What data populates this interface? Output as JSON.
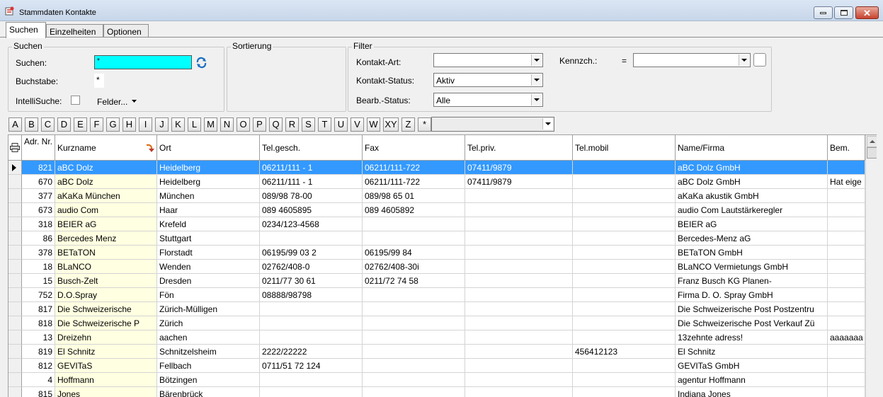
{
  "window": {
    "title": "Stammdaten Kontakte"
  },
  "tabs": [
    {
      "label": "Suchen"
    },
    {
      "label": "Einzelheiten"
    },
    {
      "label": "Optionen"
    }
  ],
  "search_group": {
    "title": "Suchen",
    "search_label": "Suchen:",
    "search_value": "*",
    "letter_label": "Buchstabe:",
    "letter_value": "*",
    "intelli_label": "IntelliSuche:",
    "fields_label": "Felder..."
  },
  "sort_group": {
    "title": "Sortierung"
  },
  "filter_group": {
    "title": "Filter",
    "type_label": "Kontakt-Art:",
    "type_value": "",
    "status_label": "Kontakt-Status:",
    "status_value": "Aktiv",
    "bearb_label": "Bearb.-Status:",
    "bearb_value": "Alle",
    "kennz_label": "Kennzch.:",
    "kennz_operator": "=",
    "kennz_value": ""
  },
  "alphabet": [
    "A",
    "B",
    "C",
    "D",
    "E",
    "F",
    "G",
    "H",
    "I",
    "J",
    "K",
    "L",
    "M",
    "N",
    "O",
    "P",
    "Q",
    "R",
    "S",
    "T",
    "U",
    "V",
    "W",
    "XY",
    "Z",
    "*"
  ],
  "alphabet_filter_value": "",
  "grid": {
    "columns": [
      {
        "label": "Adr. Nr."
      },
      {
        "label": "Kurzname"
      },
      {
        "label": "Ort"
      },
      {
        "label": "Tel.gesch."
      },
      {
        "label": "Fax"
      },
      {
        "label": "Tel.priv."
      },
      {
        "label": "Tel.mobil"
      },
      {
        "label": "Name/Firma"
      },
      {
        "label": "Bem."
      }
    ],
    "rows": [
      {
        "nr": "821",
        "kurz": "aBC Dolz",
        "ort": "Heidelberg",
        "tel": "06211/111 - 1",
        "fax": "06211/111-722",
        "priv": "07411/9879",
        "mobil": "",
        "name": "aBC Dolz GmbH",
        "bem": ""
      },
      {
        "nr": "670",
        "kurz": "aBC Dolz",
        "ort": "Heidelberg",
        "tel": "06211/111 - 1",
        "fax": "06211/111-722",
        "priv": "07411/9879",
        "mobil": "",
        "name": "aBC Dolz GmbH",
        "bem": "Hat eige"
      },
      {
        "nr": "377",
        "kurz": "aKaKa München",
        "ort": "München",
        "tel": "089/98 78-00",
        "fax": "089/98 65 01",
        "priv": "",
        "mobil": "",
        "name": "aKaKa akustik GmbH",
        "bem": ""
      },
      {
        "nr": "673",
        "kurz": "audio Com",
        "ort": "Haar",
        "tel": "089 4605895",
        "fax": "089 4605892",
        "priv": "",
        "mobil": "",
        "name": "audio Com Lautstärkeregler",
        "bem": ""
      },
      {
        "nr": "318",
        "kurz": "BEIER aG",
        "ort": "Krefeld",
        "tel": "0234/123-4568",
        "fax": "",
        "priv": "",
        "mobil": "",
        "name": "BEIER aG",
        "bem": ""
      },
      {
        "nr": "86",
        "kurz": "Bercedes Menz",
        "ort": "Stuttgart",
        "tel": "",
        "fax": "",
        "priv": "",
        "mobil": "",
        "name": "Bercedes-Menz aG",
        "bem": ""
      },
      {
        "nr": "378",
        "kurz": "BETaTON",
        "ort": "Florstadt",
        "tel": "06195/99 03 2",
        "fax": "06195/99 84",
        "priv": "",
        "mobil": "",
        "name": "BETaTON GmbH",
        "bem": ""
      },
      {
        "nr": "18",
        "kurz": "BLaNCO",
        "ort": "Wenden",
        "tel": "02762/408-0",
        "fax": "02762/408-30i",
        "priv": "",
        "mobil": "",
        "name": "BLaNCO Vermietungs GmbH",
        "bem": ""
      },
      {
        "nr": "15",
        "kurz": "Busch-Zelt",
        "ort": "Dresden",
        "tel": "0211/77 30 61",
        "fax": "0211/72 74 58",
        "priv": "",
        "mobil": "",
        "name": "Franz Busch KG Planen-",
        "bem": ""
      },
      {
        "nr": "752",
        "kurz": "D.O.Spray",
        "ort": "Fön",
        "tel": "08888/98798",
        "fax": "",
        "priv": "",
        "mobil": "",
        "name": "Firma D. O. Spray GmbH",
        "bem": ""
      },
      {
        "nr": "817",
        "kurz": "Die Schweizerische",
        "ort": "Zürich-Mülligen",
        "tel": "",
        "fax": "",
        "priv": "",
        "mobil": "",
        "name": "Die Schweizerische Post  Postzentru",
        "bem": ""
      },
      {
        "nr": "818",
        "kurz": "Die Schweizerische P",
        "ort": "Zürich",
        "tel": "",
        "fax": "",
        "priv": "",
        "mobil": "",
        "name": "Die Schweizerische Post  Verkauf Zü",
        "bem": ""
      },
      {
        "nr": "13",
        "kurz": "Dreizehn",
        "ort": "aachen",
        "tel": "",
        "fax": "",
        "priv": "",
        "mobil": "",
        "name": "13zehnte adress!",
        "bem": "aaaaaaa"
      },
      {
        "nr": "819",
        "kurz": "El Schnitz",
        "ort": "Schnitzelsheim",
        "tel": "2222/22222",
        "fax": "",
        "priv": "",
        "mobil": "456412123",
        "name": "El Schnitz",
        "bem": ""
      },
      {
        "nr": "812",
        "kurz": "GEVITaS",
        "ort": "Fellbach",
        "tel": "0711/51 72 124",
        "fax": "",
        "priv": "",
        "mobil": "",
        "name": "GEVITaS GmbH",
        "bem": ""
      },
      {
        "nr": "4",
        "kurz": "Hoffmann",
        "ort": "Bötzingen",
        "tel": "",
        "fax": "",
        "priv": "",
        "mobil": "",
        "name": "agentur Hoffmann",
        "bem": ""
      },
      {
        "nr": "815",
        "kurz": "Jones",
        "ort": "Bärenbrück",
        "tel": "",
        "fax": "",
        "priv": "",
        "mobil": "",
        "name": "Indiana Jones",
        "bem": ""
      }
    ]
  }
}
